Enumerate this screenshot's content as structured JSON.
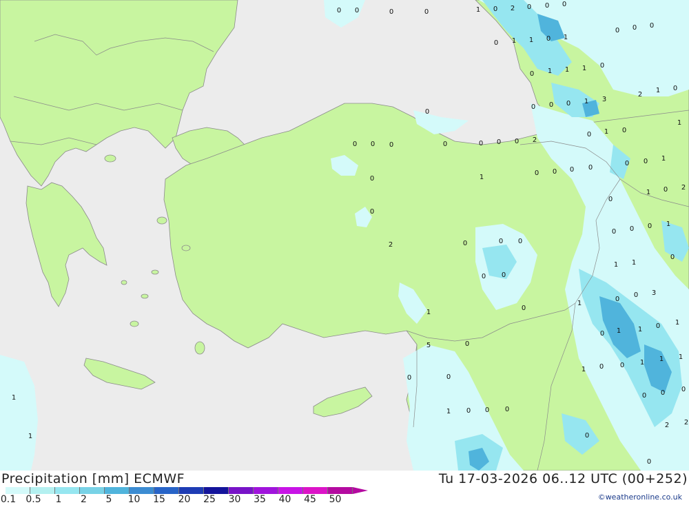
{
  "header": {
    "title": "Precipitation [mm] ECMWF",
    "datetime": "Tu 17-03-2026 06..12 UTC (00+252)",
    "credit": "©weatheronline.co.uk"
  },
  "legend": {
    "labels": [
      "0.1",
      "0.5",
      "1",
      "2",
      "5",
      "10",
      "15",
      "20",
      "25",
      "30",
      "35",
      "40",
      "45",
      "50"
    ],
    "colors": [
      "#d4fafa",
      "#b4f0f0",
      "#96e6f0",
      "#78d2e6",
      "#50b4dc",
      "#3c8cd2",
      "#2864c8",
      "#1e3cb4",
      "#14149b",
      "#7814c8",
      "#a014dc",
      "#c814e6",
      "#dc14c8",
      "#b40aa0"
    ]
  },
  "map": {
    "colors": {
      "sea": "#ececec",
      "land": "#c8f5a0",
      "precip_light": "#d4fafa",
      "precip_med": "#96e6f0",
      "precip_heavy": "#50b4dc",
      "border": "#8a8a8a"
    },
    "value_labels": [
      "0",
      "0",
      "0",
      "0",
      "1",
      "0",
      "2",
      "0",
      "0",
      "0",
      "0",
      "0",
      "0",
      "0",
      "1",
      "1",
      "0",
      "1",
      "0",
      "1",
      "1",
      "1",
      "0",
      "0",
      "0",
      "0",
      "0",
      "1",
      "3",
      "2",
      "1",
      "0",
      "1",
      "0",
      "0",
      "0",
      "0",
      "0",
      "0",
      "0",
      "2",
      "0",
      "1",
      "0",
      "0",
      "0",
      "0",
      "0",
      "1",
      "0",
      "0",
      "1",
      "0",
      "0",
      "1",
      "0",
      "2",
      "0",
      "0",
      "0",
      "0",
      "1",
      "2",
      "0",
      "0",
      "0",
      "0",
      "1",
      "1",
      "0",
      "0",
      "0",
      "3",
      "1",
      "0",
      "1",
      "0",
      "0",
      "1",
      "1",
      "0",
      "1",
      "5",
      "0",
      "1",
      "0",
      "0",
      "1",
      "1",
      "1",
      "0",
      "0",
      "0",
      "0",
      "0",
      "1",
      "0",
      "0",
      "0",
      "1",
      "1",
      "2",
      "2",
      "0",
      "0"
    ]
  }
}
